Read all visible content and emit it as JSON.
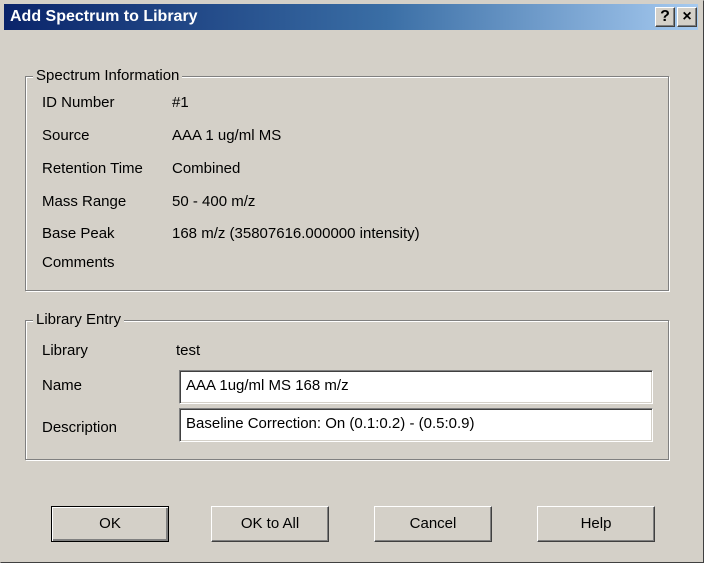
{
  "window": {
    "title": "Add Spectrum to Library",
    "help_glyph": "?",
    "close_glyph": "×"
  },
  "spectrum_info": {
    "legend": "Spectrum Information",
    "rows": [
      {
        "label": "ID Number",
        "value": "#1"
      },
      {
        "label": "Source",
        "value": "AAA 1 ug/ml MS"
      },
      {
        "label": "Retention Time",
        "value": "Combined"
      },
      {
        "label": "Mass Range",
        "value": "50 - 400 m/z"
      },
      {
        "label": "Base Peak",
        "value": "168 m/z (35807616.000000 intensity)"
      },
      {
        "label": "Comments",
        "value": ""
      }
    ]
  },
  "library_entry": {
    "legend": "Library Entry",
    "library_label": "Library",
    "library_value": "test",
    "name_label": "Name",
    "name_value": "AAA 1ug/ml MS 168 m/z",
    "description_label": "Description",
    "description_value": "Baseline Correction: On (0.1:0.2)  - (0.5:0.9)"
  },
  "buttons": {
    "ok": "OK",
    "ok_to_all": "OK to All",
    "cancel": "Cancel",
    "help": "Help"
  },
  "colors": {
    "face": "#d4d0c8",
    "title_start": "#0a246a",
    "title_end": "#a6caf0"
  }
}
